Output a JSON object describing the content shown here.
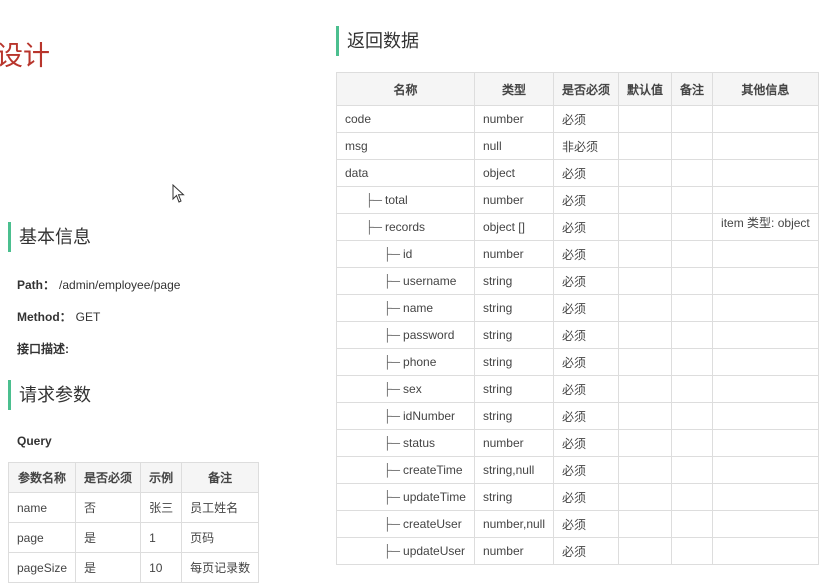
{
  "page_title": "设计",
  "basic_info": {
    "heading": "基本信息",
    "path_label": "Path：",
    "path_value": "/admin/employee/page",
    "method_label": "Method：",
    "method_value": "GET",
    "desc_label": "接口描述:"
  },
  "request": {
    "heading": "请求参数",
    "query_label": "Query",
    "columns": [
      "参数名称",
      "是否必须",
      "示例",
      "备注"
    ],
    "rows": [
      [
        "name",
        "否",
        "张三",
        "员工姓名"
      ],
      [
        "page",
        "是",
        "1",
        "页码"
      ],
      [
        "pageSize",
        "是",
        "10",
        "每页记录数"
      ]
    ]
  },
  "response": {
    "heading": "返回数据",
    "columns": [
      "名称",
      "类型",
      "是否必须",
      "默认值",
      "备注",
      "其他信息"
    ],
    "rows": [
      {
        "name": "code",
        "level": 0,
        "type": "number",
        "required": "必须",
        "default": "",
        "note": "",
        "other": ""
      },
      {
        "name": "msg",
        "level": 0,
        "type": "null",
        "required": "非必须",
        "default": "",
        "note": "",
        "other": ""
      },
      {
        "name": "data",
        "level": 0,
        "type": "object",
        "required": "必须",
        "default": "",
        "note": "",
        "other": ""
      },
      {
        "name": "total",
        "level": 1,
        "type": "number",
        "required": "必须",
        "default": "",
        "note": "",
        "other": ""
      },
      {
        "name": "records",
        "level": 1,
        "type": "object []",
        "required": "必须",
        "default": "",
        "note": "",
        "other": "item 类型: object"
      },
      {
        "name": "id",
        "level": 2,
        "type": "number",
        "required": "必须",
        "default": "",
        "note": "",
        "other": ""
      },
      {
        "name": "username",
        "level": 2,
        "type": "string",
        "required": "必须",
        "default": "",
        "note": "",
        "other": ""
      },
      {
        "name": "name",
        "level": 2,
        "type": "string",
        "required": "必须",
        "default": "",
        "note": "",
        "other": ""
      },
      {
        "name": "password",
        "level": 2,
        "type": "string",
        "required": "必须",
        "default": "",
        "note": "",
        "other": ""
      },
      {
        "name": "phone",
        "level": 2,
        "type": "string",
        "required": "必须",
        "default": "",
        "note": "",
        "other": ""
      },
      {
        "name": "sex",
        "level": 2,
        "type": "string",
        "required": "必须",
        "default": "",
        "note": "",
        "other": ""
      },
      {
        "name": "idNumber",
        "level": 2,
        "type": "string",
        "required": "必须",
        "default": "",
        "note": "",
        "other": ""
      },
      {
        "name": "status",
        "level": 2,
        "type": "number",
        "required": "必须",
        "default": "",
        "note": "",
        "other": ""
      },
      {
        "name": "createTime",
        "level": 2,
        "type": "string,null",
        "required": "必须",
        "default": "",
        "note": "",
        "other": ""
      },
      {
        "name": "updateTime",
        "level": 2,
        "type": "string",
        "required": "必须",
        "default": "",
        "note": "",
        "other": ""
      },
      {
        "name": "createUser",
        "level": 2,
        "type": "number,null",
        "required": "必须",
        "default": "",
        "note": "",
        "other": ""
      },
      {
        "name": "updateUser",
        "level": 2,
        "type": "number",
        "required": "必须",
        "default": "",
        "note": "",
        "other": ""
      }
    ]
  },
  "tree_glyph": "├─",
  "colors": {
    "title": "#b8352c",
    "accent_bar": "#4bbf8f",
    "border": "#dddddd"
  },
  "icons": {
    "cursor": "mouse-pointer-icon"
  }
}
